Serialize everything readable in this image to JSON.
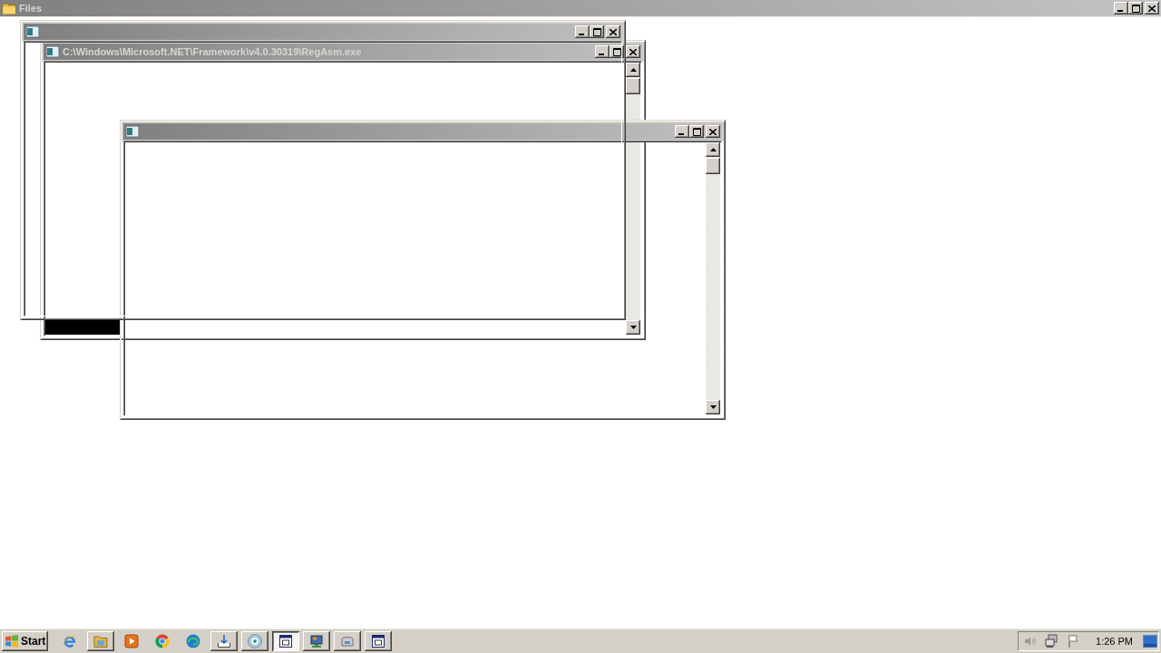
{
  "main_window": {
    "title": "Files",
    "active": false
  },
  "windows": [
    {
      "kind": "plain",
      "active": false
    },
    {
      "kind": "scrolling",
      "title": "C:\\Windows\\Microsoft.NET\\Framework\\v4.0.30319\\RegAsm.exe",
      "active": false,
      "dark_strip": true
    },
    {
      "kind": "scrolling",
      "active": false
    }
  ],
  "taskbar": {
    "start_button": {
      "label": "Start"
    },
    "items": [
      {
        "kind": "launcher"
      },
      {
        "kind": "task",
        "selected": false
      },
      {
        "kind": "launcher"
      },
      {
        "kind": "launcher"
      },
      {
        "kind": "launcher"
      },
      {
        "kind": "task",
        "selected": false
      },
      {
        "kind": "task",
        "selected": false
      },
      {
        "kind": "task",
        "selected": true
      },
      {
        "kind": "task",
        "selected": false
      },
      {
        "kind": "task",
        "selected": false
      },
      {
        "kind": "task",
        "selected": false
      }
    ],
    "clock": "1:26 PM"
  }
}
